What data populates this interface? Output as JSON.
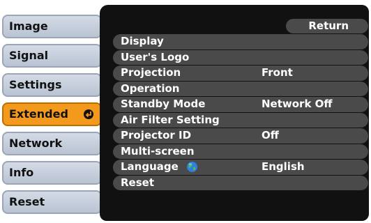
{
  "tabs": [
    {
      "label": "Image"
    },
    {
      "label": "Signal"
    },
    {
      "label": "Settings"
    },
    {
      "label": "Extended",
      "active": true
    },
    {
      "label": "Network"
    },
    {
      "label": "Info"
    },
    {
      "label": "Reset"
    }
  ],
  "panel": {
    "return_label": "Return",
    "items": [
      {
        "label": "Display",
        "value": ""
      },
      {
        "label": "User's Logo",
        "value": ""
      },
      {
        "label": "Projection",
        "value": "Front"
      },
      {
        "label": "Operation",
        "value": ""
      },
      {
        "label": "Standby Mode",
        "value": "Network Off"
      },
      {
        "label": "Air Filter Setting",
        "value": ""
      },
      {
        "label": "Projector ID",
        "value": "Off"
      },
      {
        "label": "Multi-screen",
        "value": ""
      },
      {
        "label": "Language",
        "value": "English",
        "icon": "globe-icon"
      },
      {
        "label": "Reset",
        "value": ""
      }
    ]
  },
  "colors": {
    "tab_bg": "#c6cfdc",
    "tab_active": "#f39a1c",
    "panel_bg": "#111111",
    "row_bg": "#4a4a4a",
    "text_light": "#ffffff"
  }
}
